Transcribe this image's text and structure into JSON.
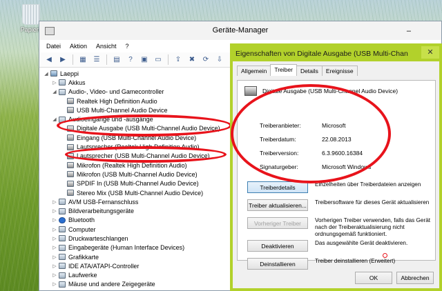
{
  "desktop": {
    "recycle_bin_label": "Papierk"
  },
  "device_manager": {
    "title": "Geräte-Manager",
    "minimize": "–",
    "menu": [
      "Datei",
      "Aktion",
      "Ansicht",
      "?"
    ],
    "tree": [
      {
        "label": "Laeppi",
        "level": 0,
        "arrow": "◢",
        "icon": "computer-icon"
      },
      {
        "label": "Akkus",
        "level": 1,
        "arrow": "▷",
        "icon": "battery-icon"
      },
      {
        "label": "Audio-, Video- und Gamecontroller",
        "level": 1,
        "arrow": "◢",
        "icon": "speaker-icon"
      },
      {
        "label": "Realtek High Definition Audio",
        "level": 2,
        "arrow": "",
        "icon": "audio-device-icon"
      },
      {
        "label": "USB Multi-Channel Audio Device",
        "level": 2,
        "arrow": "",
        "icon": "audio-device-icon"
      },
      {
        "label": "Audioeingänge und -ausgänge",
        "level": 1,
        "arrow": "◢",
        "icon": "speaker-icon"
      },
      {
        "label": "Digitale Ausgabe (USB Multi-Channel Audio Device)",
        "level": 2,
        "arrow": "",
        "icon": "digital-output-icon"
      },
      {
        "label": "Eingang (USB Multi-Channel Audio Device)",
        "level": 2,
        "arrow": "",
        "icon": "input-icon"
      },
      {
        "label": "Lautsprecher (Realtek High Definition Audio)",
        "level": 2,
        "arrow": "",
        "icon": "speaker-icon"
      },
      {
        "label": "Lautsprecher (USB Multi-Channel Audio Device)",
        "level": 2,
        "arrow": "",
        "icon": "speaker-icon"
      },
      {
        "label": "Mikrofon (Realtek High Definition Audio)",
        "level": 2,
        "arrow": "",
        "icon": "microphone-icon"
      },
      {
        "label": "Mikrofon (USB Multi-Channel Audio Device)",
        "level": 2,
        "arrow": "",
        "icon": "microphone-icon"
      },
      {
        "label": "SPDIF In (USB Multi-Channel Audio Device)",
        "level": 2,
        "arrow": "",
        "icon": "spdif-icon"
      },
      {
        "label": "Stereo Mix (USB Multi-Channel Audio Device)",
        "level": 2,
        "arrow": "",
        "icon": "stereo-mix-icon"
      },
      {
        "label": "AVM USB-Fernanschluss",
        "level": 1,
        "arrow": "▷",
        "icon": "usb-icon"
      },
      {
        "label": "Bildverarbeitungsgeräte",
        "level": 1,
        "arrow": "▷",
        "icon": "camera-icon"
      },
      {
        "label": "Bluetooth",
        "level": 1,
        "arrow": "▷",
        "icon": "bluetooth-icon"
      },
      {
        "label": "Computer",
        "level": 1,
        "arrow": "▷",
        "icon": "computer-icon"
      },
      {
        "label": "Druckwarteschlangen",
        "level": 1,
        "arrow": "▷",
        "icon": "printer-icon"
      },
      {
        "label": "Eingabegeräte (Human Interface Devices)",
        "level": 1,
        "arrow": "▷",
        "icon": "hid-icon"
      },
      {
        "label": "Grafikkarte",
        "level": 1,
        "arrow": "▷",
        "icon": "display-adapter-icon"
      },
      {
        "label": "IDE ATA/ATAPI-Controller",
        "level": 1,
        "arrow": "▷",
        "icon": "ide-controller-icon"
      },
      {
        "label": "Laufwerke",
        "level": 1,
        "arrow": "▷",
        "icon": "drive-icon"
      },
      {
        "label": "Mäuse und andere Zeigegeräte",
        "level": 1,
        "arrow": "▷",
        "icon": "mouse-icon"
      }
    ]
  },
  "properties": {
    "title": "Eigenschaften von Digitale Ausgabe (USB Multi-Chan",
    "close": "✕",
    "tabs": [
      "Allgemein",
      "Treiber",
      "Details",
      "Ereignisse"
    ],
    "device_name": "Digitale Ausgabe (USB Multi-Channel Audio Device)",
    "fields": [
      {
        "key": "Treiberanbieter:",
        "value": "Microsoft"
      },
      {
        "key": "Treiberdatum:",
        "value": "22.08.2013"
      },
      {
        "key": "Treiberversion:",
        "value": "6.3.9600.16384"
      },
      {
        "key": "Signaturgeber:",
        "value": "Microsoft Windows"
      }
    ],
    "buttons": [
      {
        "label": "Treiberdetails",
        "desc": "Einzelheiten über Treiberdateien anzeigen",
        "disabled": false
      },
      {
        "label": "Treiber aktualisieren...",
        "desc": "Treibersoftware für dieses Gerät aktualisieren",
        "disabled": false
      },
      {
        "label": "Vorheriger Treiber",
        "desc": "Vorherigen Treiber verwenden, falls das Gerät nach der Treiberaktualisierung nicht ordnungsgemäß funktioniert.",
        "disabled": true
      },
      {
        "label": "Deaktivieren",
        "desc": "Das ausgewählte Gerät deaktivieren.",
        "disabled": false
      },
      {
        "label": "Deinstallieren",
        "desc": "Treiber deinstallieren (Erweitert)",
        "disabled": false
      }
    ],
    "ok": "OK",
    "cancel": "Abbrechen"
  },
  "colors": {
    "annotation_red": "#e8131b",
    "dialog_accent": "#b2d12b"
  }
}
